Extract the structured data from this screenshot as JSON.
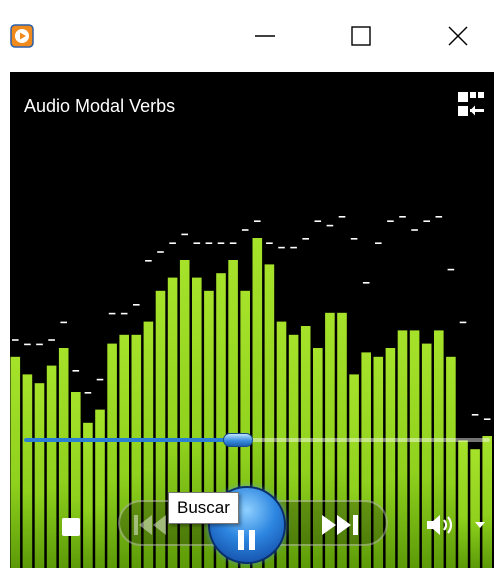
{
  "window": {
    "icon": "media-player-app-icon",
    "buttons": {
      "minimize_icon": "minimize-icon",
      "maximize_icon": "maximize-icon",
      "close_icon": "close-icon"
    }
  },
  "player": {
    "title": "Audio Modal Verbs",
    "switch_view_icon": "switch-to-library-icon",
    "seek_progress": 0.46,
    "tooltip": "Buscar",
    "controls": {
      "stop_icon": "stop-icon",
      "previous_icon": "previous-icon",
      "play_pause_icon": "pause-icon",
      "next_icon": "next-icon",
      "volume_icon": "volume-icon",
      "volume_menu_icon": "chevron-down-icon"
    }
  },
  "visualizer": {
    "bar_levels": [
      0.48,
      0.44,
      0.42,
      0.46,
      0.5,
      0.4,
      0.33,
      0.36,
      0.51,
      0.53,
      0.53,
      0.56,
      0.63,
      0.66,
      0.7,
      0.66,
      0.63,
      0.67,
      0.7,
      0.63,
      0.75,
      0.69,
      0.56,
      0.53,
      0.55,
      0.5,
      0.58,
      0.58,
      0.44,
      0.49,
      0.48,
      0.5,
      0.54,
      0.54,
      0.51,
      0.54,
      0.48,
      0.29,
      0.27,
      0.3
    ],
    "peak_levels": [
      0.52,
      0.51,
      0.51,
      0.52,
      0.56,
      0.45,
      0.4,
      0.43,
      0.58,
      0.58,
      0.6,
      0.7,
      0.72,
      0.74,
      0.76,
      0.74,
      0.74,
      0.74,
      0.74,
      0.77,
      0.79,
      0.74,
      0.73,
      0.73,
      0.75,
      0.79,
      0.78,
      0.8,
      0.75,
      0.65,
      0.74,
      0.79,
      0.8,
      0.77,
      0.79,
      0.8,
      0.68,
      0.56,
      0.35,
      0.34
    ],
    "bar_color": "#8fd11d",
    "peak_color": "#ffffff"
  }
}
